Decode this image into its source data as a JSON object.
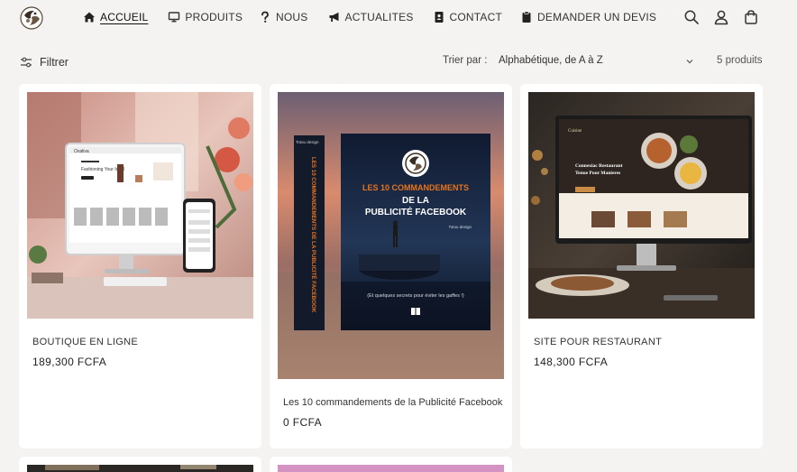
{
  "header": {
    "nav": [
      {
        "label": "ACCUEIL",
        "icon": "home-icon",
        "active": true
      },
      {
        "label": "PRODUITS",
        "icon": "monitor-icon"
      },
      {
        "label": "NOUS",
        "icon": "question-icon"
      },
      {
        "label": "ACTUALITES",
        "icon": "megaphone-icon"
      },
      {
        "label": "CONTACT",
        "icon": "contact-card-icon"
      },
      {
        "label": "DEMANDER UN DEVIS",
        "icon": "clipboard-icon"
      }
    ],
    "icons": [
      "search-icon",
      "account-icon",
      "cart-icon"
    ]
  },
  "toolbar": {
    "filter_label": "Filtrer",
    "sort_label": "Trier par :",
    "sort_value": "Alphabétique, de A à Z",
    "product_count": "5 produits"
  },
  "products": [
    {
      "title": "BOUTIQUE EN LIGNE",
      "price": "189,300 FCFA",
      "image": {
        "subject": "ecommerce-site-mockup",
        "mockup_logo": "Ovaliva",
        "mockup_headline": "Fashioning Your Ideal"
      }
    },
    {
      "title": "Les 10 commandements de la Publicité Facebook",
      "price": "0 FCFA",
      "image": {
        "subject": "ebook-cover",
        "spine_brand": "Totou design",
        "spine_title": "LES 10 COMMANDEMENTS DE LA PUBLICITÉ FACEBOOK",
        "cover_line1": "LES 10 COMMANDEMENTS",
        "cover_line2": "DE LA",
        "cover_line3": "PUBLICITÉ FACEBOOK",
        "cover_brand": "Totou design",
        "cover_tagline": "(Et quelques secrets pour éviter les gaffes !)"
      }
    },
    {
      "title": "SITE POUR RESTAURANT",
      "price": "148,300 FCFA",
      "image": {
        "subject": "restaurant-site-mockup",
        "mockup_logo": "Cuisine",
        "mockup_headline1": "Connexiac Restaurant",
        "mockup_headline2": "Tenue Pour Manieres"
      }
    }
  ],
  "colors": {
    "background": "#f4f3f1",
    "card": "#ffffff",
    "text": "#222222",
    "cover_orange": "#e8731d",
    "cover_navy": "#16213a"
  }
}
